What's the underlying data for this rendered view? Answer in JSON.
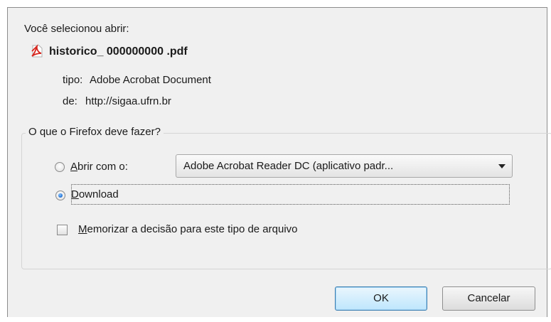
{
  "dialog": {
    "intro": "Você selecionou abrir:",
    "file_name": "historico_ 000000000 .pdf",
    "type_label": "tipo:",
    "type_value": "Adobe Acrobat Document",
    "from_label": "de:",
    "from_value": "http://sigaa.ufrn.br"
  },
  "group": {
    "legend": "O que o Firefox deve fazer?",
    "open_with": {
      "accel": "A",
      "rest": "brir com o:",
      "checked": false
    },
    "app_select": {
      "value": "Adobe Acrobat Reader DC  (aplicativo padr..."
    },
    "download": {
      "accel": "D",
      "rest": "ownload",
      "checked": true
    },
    "remember": {
      "accel": "M",
      "rest": "emorizar a decisão para este tipo de arquivo",
      "checked": false
    }
  },
  "buttons": {
    "ok": "OK",
    "cancel": "Cancelar"
  },
  "icons": {
    "file_icon": "pdf-file-icon",
    "select_arrow": "chevron-down-icon"
  },
  "colors": {
    "pdf_red": "#d7261e",
    "radio_blue": "#2a78d8"
  }
}
